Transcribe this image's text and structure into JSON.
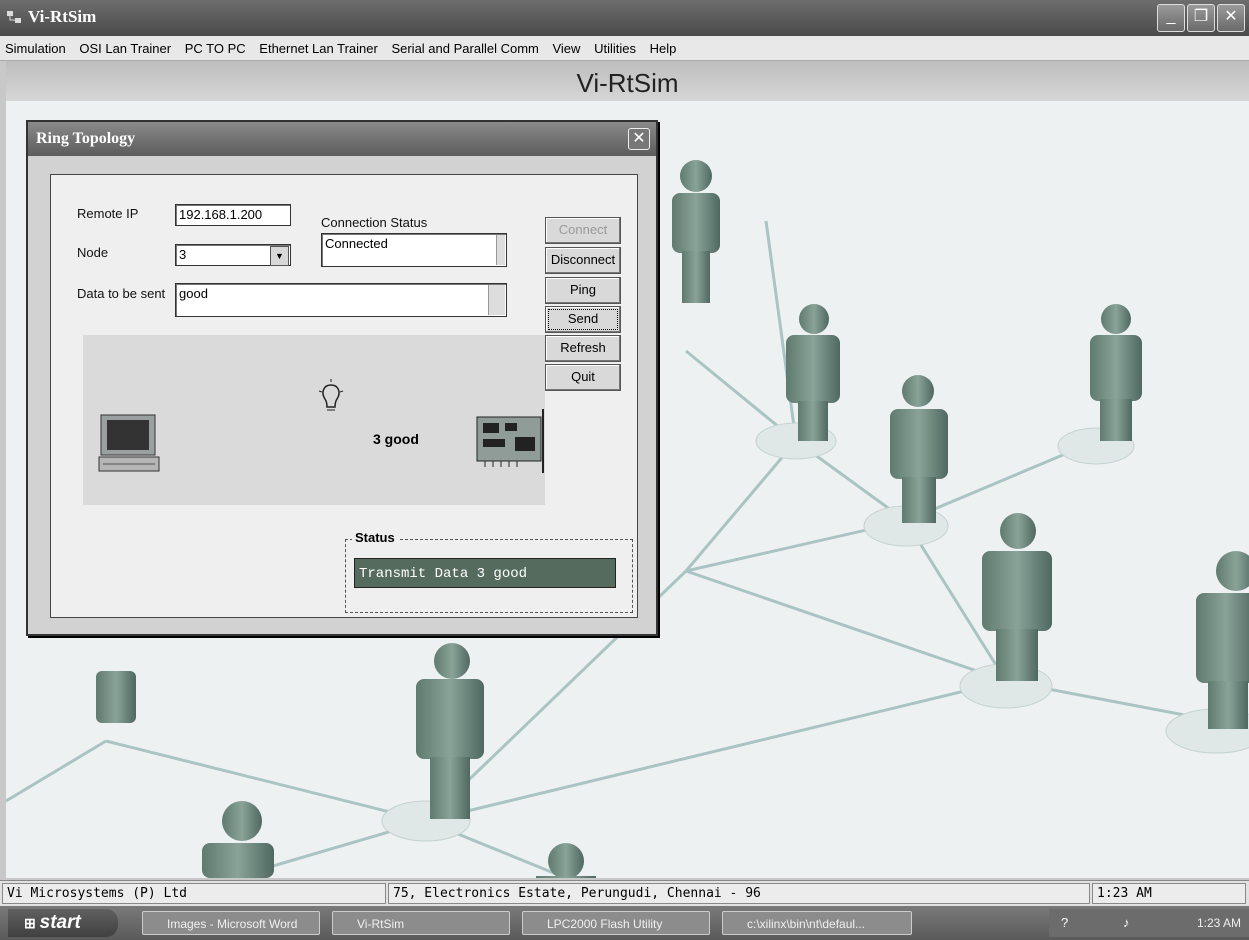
{
  "app": {
    "title": "Vi-RtSim",
    "banner": "Vi-RtSim"
  },
  "menu": [
    "Simulation",
    "OSI Lan Trainer",
    "PC TO PC",
    "Ethernet Lan Trainer",
    "Serial and Parallel Comm",
    "View",
    "Utilities",
    "Help"
  ],
  "dialog": {
    "title": "Ring Topology",
    "remote_ip_label": "Remote IP",
    "remote_ip_value": "192.168.1.200",
    "node_label": "Node",
    "node_value": "3",
    "data_label": "Data to be sent",
    "data_value": "good",
    "connection_status_label": "Connection Status",
    "connection_status_value": "Connected",
    "buttons": {
      "connect": "Connect",
      "disconnect": "Disconnect",
      "ping": "Ping",
      "send": "Send",
      "refresh": "Refresh",
      "quit": "Quit"
    },
    "sim_text": "3 good",
    "status_legend": "Status",
    "status_value": "Transmit Data 3 good"
  },
  "statusbar": {
    "company": "Vi Microsystems (P) Ltd",
    "address": "75, Electronics Estate, Perungudi, Chennai - 96",
    "time": "1:23 AM"
  },
  "taskbar": {
    "start": "start",
    "tasks": [
      "Images - Microsoft Word",
      "Vi-RtSim",
      "LPC2000 Flash Utility",
      "c:\\xilinx\\bin\\nt\\defaul..."
    ],
    "clock": "1:23 AM"
  },
  "colors": {
    "status_bg": "#556b5e",
    "title_gradient": "#5c5c5c"
  },
  "icons": [
    "app-icon",
    "minimize-icon",
    "maximize-icon",
    "close-icon",
    "computer-icon",
    "lightbulb-icon",
    "network-card-icon",
    "windows-flag-icon"
  ]
}
